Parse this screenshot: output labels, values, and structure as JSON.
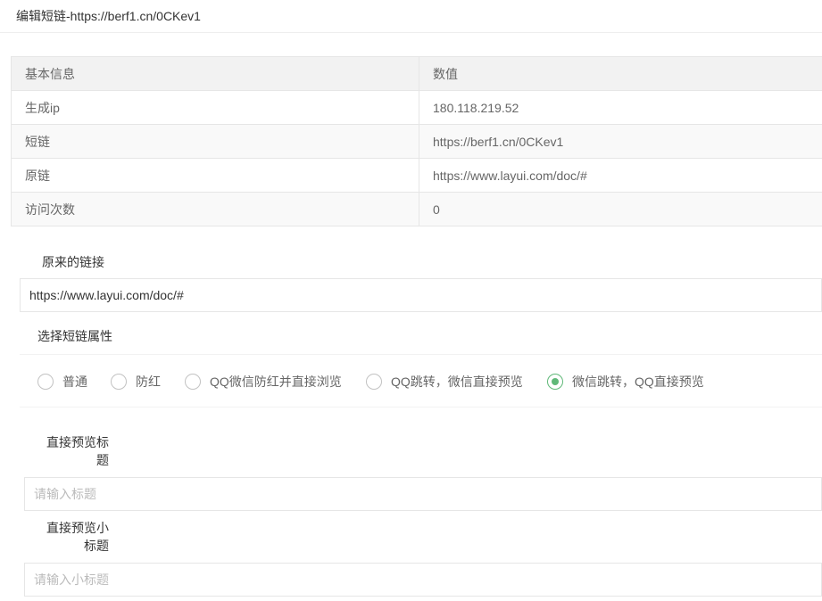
{
  "header": {
    "title": "编辑短链-https://berf1.cn/0CKev1"
  },
  "info_table": {
    "columns": [
      "基本信息",
      "数值"
    ],
    "rows": [
      [
        "生成ip",
        "180.118.219.52"
      ],
      [
        "短链",
        "https://berf1.cn/0CKev1"
      ],
      [
        "原链",
        "https://www.layui.com/doc/#"
      ],
      [
        "访问次数",
        "0"
      ]
    ]
  },
  "form": {
    "original_link_label": "原来的链接",
    "original_link_value": "https://www.layui.com/doc/#",
    "attr_label": "选择短链属性",
    "options": [
      {
        "label": "普通",
        "checked": false
      },
      {
        "label": "防红",
        "checked": false
      },
      {
        "label": "QQ微信防红并直接浏览",
        "checked": false
      },
      {
        "label": "QQ跳转，微信直接预览",
        "checked": false
      },
      {
        "label": "微信跳转，QQ直接预览",
        "checked": true
      }
    ],
    "preview_title_label_line1": "直接预览标",
    "preview_title_label_line2": "题",
    "preview_title_placeholder": "请输入标题",
    "preview_subtitle_label_line1": "直接预览小",
    "preview_subtitle_label_line2": "标题",
    "preview_subtitle_placeholder": "请输入小标题"
  },
  "colors": {
    "accent": "#5FB878",
    "border": "#e6e6e6",
    "header_bg": "#f2f2f2"
  }
}
